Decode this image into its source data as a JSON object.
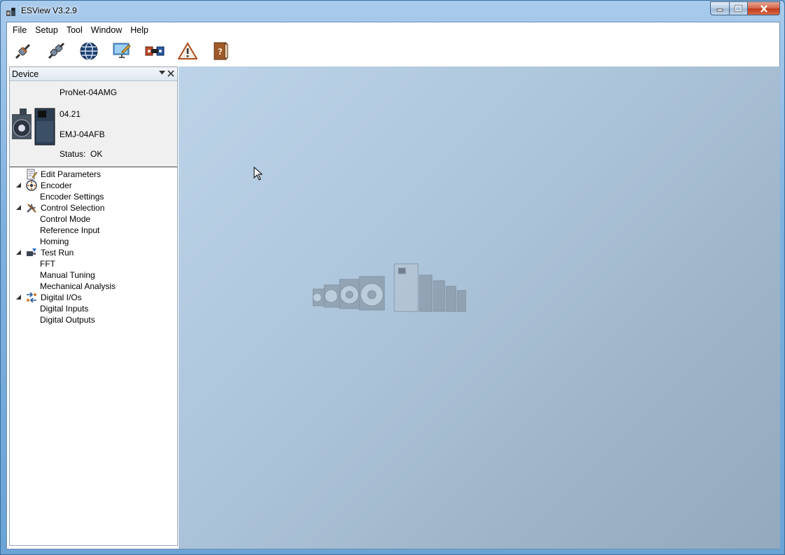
{
  "window": {
    "title": "ESView V3.2.9"
  },
  "menu": [
    "File",
    "Setup",
    "Tool",
    "Window",
    "Help"
  ],
  "toolbar": [
    "connect-icon",
    "disconnect-icon",
    "network-icon",
    "monitor-edit-icon",
    "servo-icon",
    "warning-icon",
    "help-book-icon"
  ],
  "panel": {
    "title": "Device",
    "device": {
      "model": "ProNet-04AMG",
      "version": "04.21",
      "motor": "EMJ-04AFB",
      "status_label": "Status:",
      "status_value": "OK"
    },
    "tree": [
      {
        "label": "Edit Parameters",
        "level": 0,
        "icon": "edit-parameters-icon",
        "expanded": null
      },
      {
        "label": "Encoder",
        "level": 0,
        "icon": "encoder-icon",
        "expanded": true
      },
      {
        "label": "Encoder Settings",
        "level": 1
      },
      {
        "label": "Control Selection",
        "level": 0,
        "icon": "tools-icon",
        "expanded": true
      },
      {
        "label": "Control Mode",
        "level": 1
      },
      {
        "label": "Reference Input",
        "level": 1
      },
      {
        "label": "Homing",
        "level": 1
      },
      {
        "label": "Test Run",
        "level": 0,
        "icon": "test-run-icon",
        "expanded": true
      },
      {
        "label": "FFT",
        "level": 1
      },
      {
        "label": "Manual Tuning",
        "level": 1
      },
      {
        "label": "Mechanical Analysis",
        "level": 1
      },
      {
        "label": "Digital I/Os",
        "level": 0,
        "icon": "digital-io-icon",
        "expanded": true
      },
      {
        "label": "Digital Inputs",
        "level": 1
      },
      {
        "label": "Digital Outputs",
        "level": 1
      }
    ]
  }
}
